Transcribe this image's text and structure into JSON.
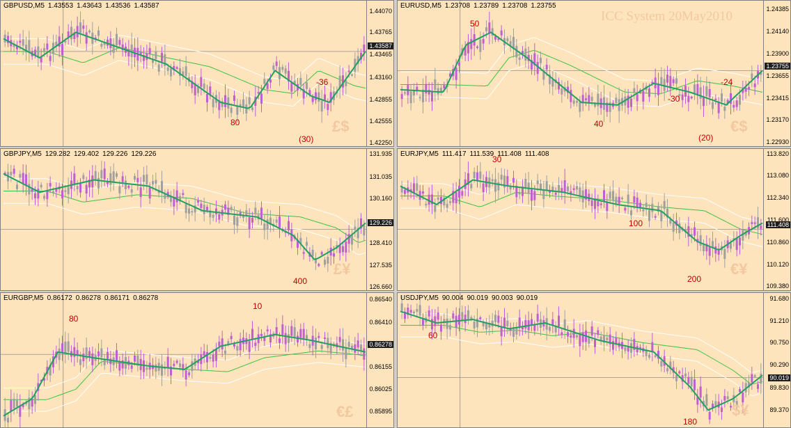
{
  "watermark": "ICC System 20May2010",
  "colors": {
    "bull": "#c060d0",
    "bear": "#a0a0a0",
    "ema": "#20a060",
    "sma": "#40c040",
    "band": "#ffffff",
    "cross": "#808080"
  },
  "charts": [
    {
      "id": "gbpusd",
      "symbol": "GBPUSD,M5",
      "ohlc": [
        "1.43553",
        "1.43643",
        "1.43536",
        "1.43587"
      ],
      "current": "1.43587",
      "ticks": [
        "1.44070",
        "1.43765",
        "1.43465",
        "1.43160",
        "1.42855",
        "1.42555",
        "1.42250"
      ],
      "pair_symbol": "£$",
      "annotations": [
        "80",
        "-36",
        "(30)"
      ]
    },
    {
      "id": "eurusd",
      "symbol": "EURUSD,M5",
      "ohlc": [
        "1.23708",
        "1.23789",
        "1.23708",
        "1.23755"
      ],
      "current": "1.23755",
      "ticks": [
        "1.24385",
        "1.24140",
        "1.23900",
        "1.23655",
        "1.23415",
        "1.23170",
        "1.22930"
      ],
      "pair_symbol": "€$",
      "annotations": [
        "50",
        "-30",
        "40",
        "-24",
        "(20)"
      ]
    },
    {
      "id": "gbpjpy",
      "symbol": "GBPJPY,M5",
      "ohlc": [
        "129.282",
        "129.402",
        "129.226",
        "129.226"
      ],
      "current": "129.226",
      "ticks": [
        "131.935",
        "131.035",
        "130.160",
        "129.285",
        "128.410",
        "127.535",
        "126.660"
      ],
      "pair_symbol": "£¥",
      "annotations": [
        "400"
      ]
    },
    {
      "id": "eurjpy",
      "symbol": "EURJPY,M5",
      "ohlc": [
        "111.417",
        "111.539",
        "111.408",
        "111.408"
      ],
      "current": "111.408",
      "ticks": [
        "113.820",
        "113.080",
        "112.340",
        "111.600",
        "110.860",
        "110.120",
        "109.380"
      ],
      "pair_symbol": "€¥",
      "annotations": [
        "30",
        "100",
        "200"
      ]
    },
    {
      "id": "eurgbp",
      "symbol": "EURGBP,M5",
      "ohlc": [
        "0.86172",
        "0.86278",
        "0.86171",
        "0.86278"
      ],
      "current": "0.86278",
      "ticks": [
        "0.86540",
        "0.86410",
        "0.86285",
        "0.86155",
        "0.86025",
        "0.85895"
      ],
      "pair_symbol": "€£",
      "annotations": [
        "80",
        "10"
      ]
    },
    {
      "id": "usdjpy",
      "symbol": "USDJPY,M5",
      "ohlc": [
        "90.004",
        "90.019",
        "90.003",
        "90.019"
      ],
      "current": "90.019",
      "ticks": [
        "91.680",
        "91.210",
        "90.750",
        "90.290",
        "89.830",
        "89.370"
      ],
      "pair_symbol": "$¥",
      "annotations": [
        "60",
        "180"
      ]
    }
  ]
}
